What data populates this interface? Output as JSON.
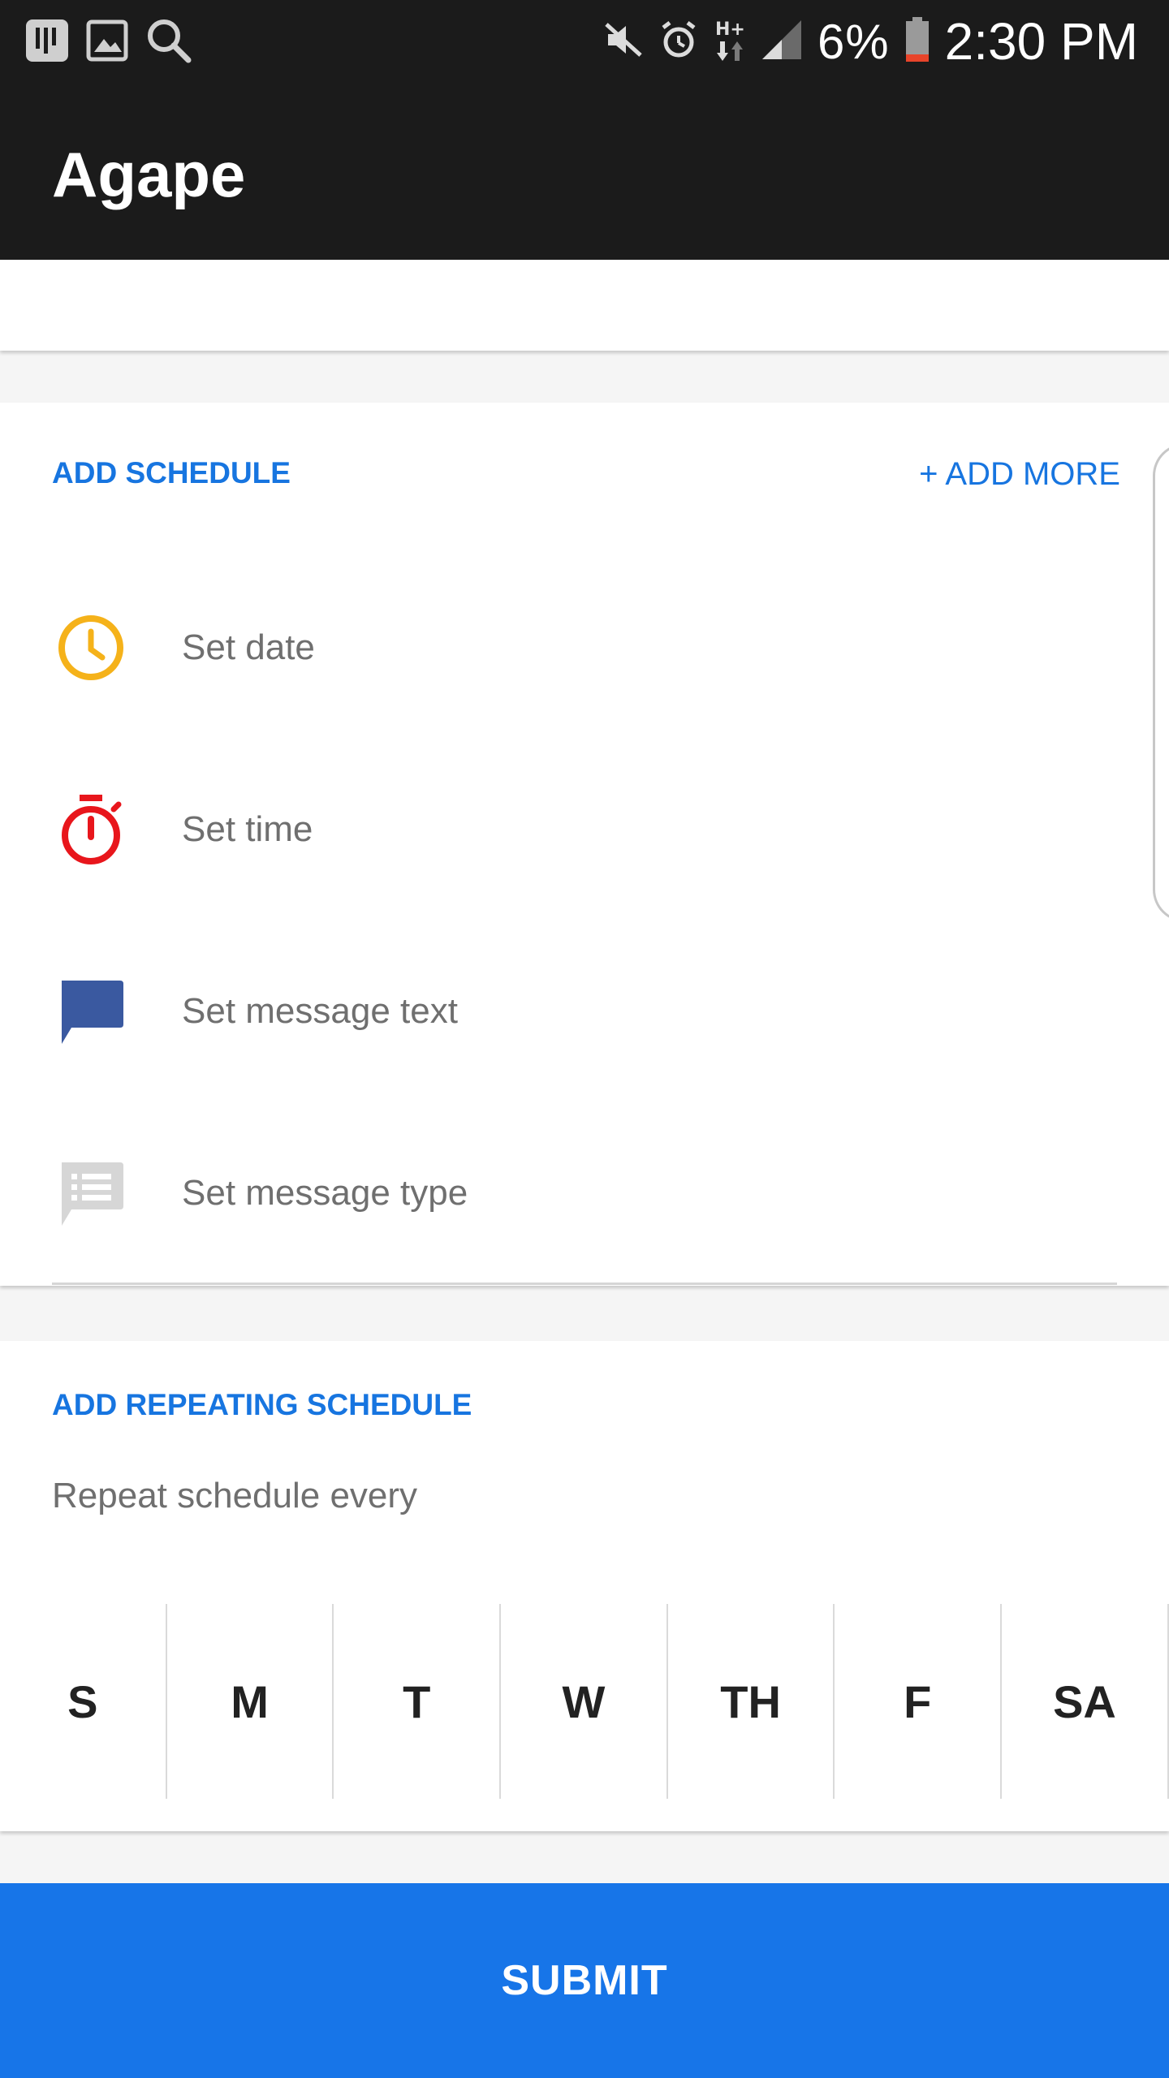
{
  "status_bar": {
    "battery": "6%",
    "time": "2:30 PM"
  },
  "app_bar": {
    "title": "Agape"
  },
  "schedule": {
    "title": "ADD SCHEDULE",
    "add_more": "+ ADD MORE",
    "rows": [
      {
        "label": "Set date",
        "icon": "clock-icon"
      },
      {
        "label": "Set time",
        "icon": "stopwatch-icon"
      },
      {
        "label": "Set message text",
        "icon": "message-bubble-icon"
      },
      {
        "label": "Set message type",
        "icon": "message-list-icon"
      }
    ]
  },
  "repeat": {
    "title": "ADD REPEATING SCHEDULE",
    "label": "Repeat schedule every",
    "days": [
      "S",
      "M",
      "T",
      "W",
      "TH",
      "F",
      "SA"
    ]
  },
  "submit": {
    "label": "SUBMIT"
  },
  "colors": {
    "accent": "#1775e0",
    "clock_icon": "#f5b21a",
    "stopwatch_icon": "#e8161c",
    "message_icon": "#3a59a0",
    "type_icon": "#d6d6d6",
    "appbar_bg": "#1b1b1b"
  }
}
